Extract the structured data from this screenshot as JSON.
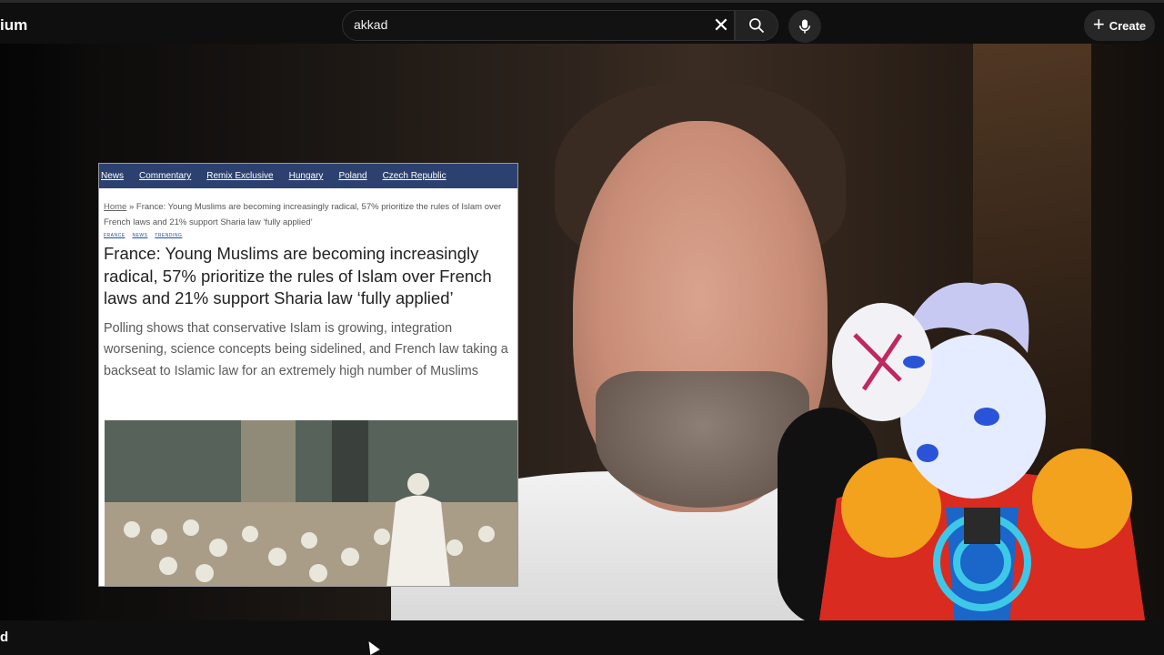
{
  "header": {
    "brand_fragment": "ium",
    "search": {
      "value": "akkad",
      "placeholder": "Search"
    },
    "create_label": "Create"
  },
  "icons": {
    "clear": "close-icon",
    "search": "search-icon",
    "mic": "mic-icon",
    "create": "plus-icon"
  },
  "article": {
    "nav": [
      "News",
      "Commentary",
      "Remix Exclusive",
      "Hungary",
      "Poland",
      "Czech Republic"
    ],
    "breadcrumb_home": "Home",
    "breadcrumb_rest": " » France: Young Muslims are becoming increasingly radical, 57% prioritize the rules of Islam over French laws and 21% support Sharia law ‘fully applied’",
    "tags": [
      "FRANCE",
      "NEWS",
      "TRENDING"
    ],
    "title": "France: Young Muslims are becoming increasingly radical, 57% prioritize the rules of Islam over French laws and 21% support Sharia law ‘fully applied’",
    "subtitle": "Polling shows that conservative Islam is growing, integration worsening, science concepts being sidelined, and French law taking a backseat to Islamic law for an extremely high number of Muslims"
  },
  "bottom": {
    "text_fragment": "d"
  },
  "colors": {
    "nav_bar": "#2d4170",
    "topbar": "#0f0f0f"
  }
}
